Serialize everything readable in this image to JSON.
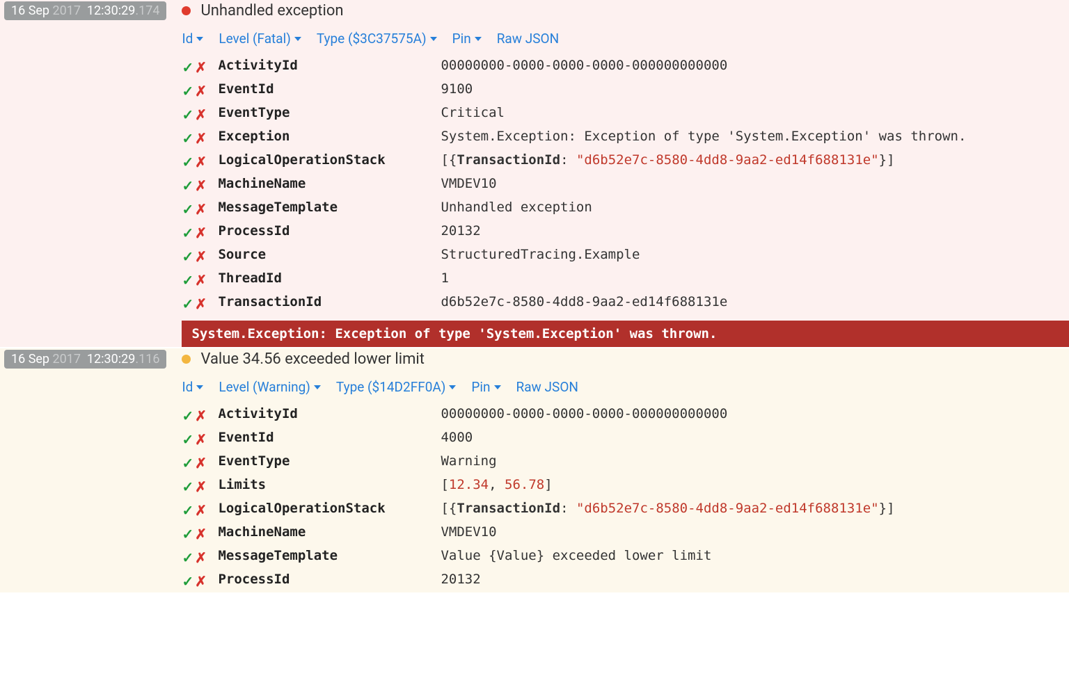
{
  "events": [
    {
      "level": "fatal",
      "ts": {
        "day": "16",
        "month": "Sep",
        "year": "2017",
        "time": "12:30:29",
        "ms": ".174"
      },
      "title": "Unhandled exception",
      "actions": {
        "id": "Id",
        "level": "Level (Fatal)",
        "type": "Type ($3C37575A)",
        "pin": "Pin",
        "raw": "Raw JSON"
      },
      "props": [
        {
          "k": "ActivityId",
          "v": "00000000-0000-0000-0000-000000000000"
        },
        {
          "k": "EventId",
          "v": "9100"
        },
        {
          "k": "EventType",
          "v": "Critical"
        },
        {
          "k": "Exception",
          "v": "System.Exception: Exception of type 'System.Exception' was thrown."
        },
        {
          "k": "LogicalOperationStack",
          "objkey": "TransactionId",
          "objval": "d6b52e7c-8580-4dd8-9aa2-ed14f688131e"
        },
        {
          "k": "MachineName",
          "v": "VMDEV10"
        },
        {
          "k": "MessageTemplate",
          "v": "Unhandled exception"
        },
        {
          "k": "ProcessId",
          "v": "20132"
        },
        {
          "k": "Source",
          "v": "StructuredTracing.Example"
        },
        {
          "k": "ThreadId",
          "v": "1"
        },
        {
          "k": "TransactionId",
          "v": "d6b52e7c-8580-4dd8-9aa2-ed14f688131e"
        }
      ],
      "errbar": "System.Exception: Exception of type 'System.Exception' was thrown."
    },
    {
      "level": "warning",
      "ts": {
        "day": "16",
        "month": "Sep",
        "year": "2017",
        "time": "12:30:29",
        "ms": ".116"
      },
      "title": "Value 34.56 exceeded lower limit",
      "actions": {
        "id": "Id",
        "level": "Level (Warning)",
        "type": "Type ($14D2FF0A)",
        "pin": "Pin",
        "raw": "Raw JSON"
      },
      "props": [
        {
          "k": "ActivityId",
          "v": "00000000-0000-0000-0000-000000000000"
        },
        {
          "k": "EventId",
          "v": "4000"
        },
        {
          "k": "EventType",
          "v": "Warning"
        },
        {
          "k": "Limits",
          "numarr": [
            "12.34",
            "56.78"
          ]
        },
        {
          "k": "LogicalOperationStack",
          "objkey": "TransactionId",
          "objval": "d6b52e7c-8580-4dd8-9aa2-ed14f688131e"
        },
        {
          "k": "MachineName",
          "v": "VMDEV10"
        },
        {
          "k": "MessageTemplate",
          "v": "Value {Value} exceeded lower limit"
        },
        {
          "k": "ProcessId",
          "v": "20132"
        }
      ]
    }
  ]
}
